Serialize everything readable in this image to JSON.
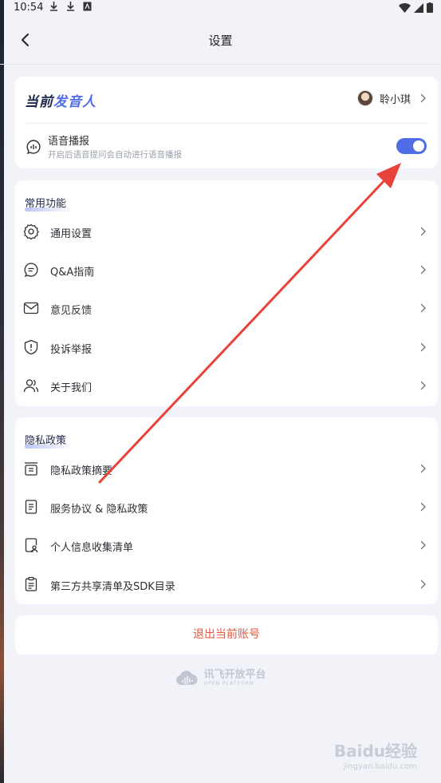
{
  "status_bar": {
    "time": "10:54",
    "notification_icons": [
      "download-icon",
      "download-icon",
      "a-icon"
    ]
  },
  "nav": {
    "title": "设置"
  },
  "speaker_card": {
    "title_part1": "当前",
    "title_part2": "发音人",
    "speaker_name": "聆小琪",
    "voice_broadcast_label": "语音播报",
    "voice_broadcast_desc": "开启后语音提问会自动进行语音播报",
    "voice_broadcast_on": true
  },
  "common": {
    "title": "常用功能",
    "items": [
      {
        "label": "通用设置",
        "icon": "gear-icon"
      },
      {
        "label": "Q&A指南",
        "icon": "chat-bubble-icon"
      },
      {
        "label": "意见反馈",
        "icon": "mail-icon"
      },
      {
        "label": "投诉举报",
        "icon": "shield-alert-icon"
      },
      {
        "label": "关于我们",
        "icon": "users-icon"
      }
    ]
  },
  "privacy": {
    "title": "隐私政策",
    "items": [
      {
        "label": "隐私政策摘要",
        "icon": "archive-icon"
      },
      {
        "label": "服务协议 & 隐私政策",
        "icon": "document-icon"
      },
      {
        "label": "个人信息收集清单",
        "icon": "user-file-icon"
      },
      {
        "label": "第三方共享清单及SDK目录",
        "icon": "clipboard-icon"
      }
    ]
  },
  "logout_label": "退出当前账号",
  "brand": {
    "name": "讯飞开放平台",
    "subtitle": "OPEN PLATFORM"
  },
  "watermark": {
    "text": "Baidu经验",
    "sub": "jingyan.baidu.com"
  },
  "colors": {
    "accent": "#4f6ee6",
    "logout": "#e8573e",
    "arrow": "#e8433a",
    "background": "#f1f3f9"
  }
}
